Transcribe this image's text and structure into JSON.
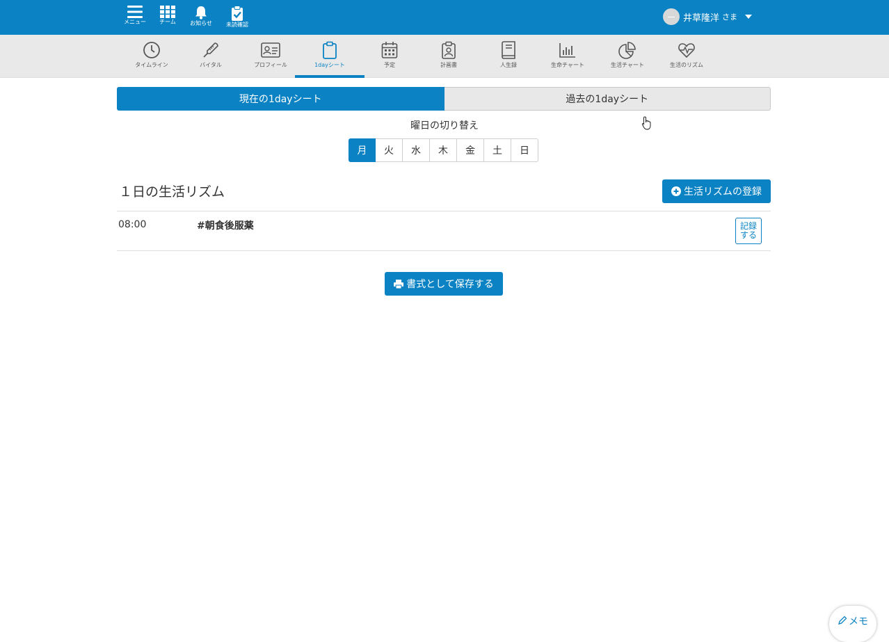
{
  "colors": {
    "brand": "#0a82c3",
    "navbar_bg": "#e9e9e9",
    "inactive_tab_bg": "#e8e8e8"
  },
  "topbar": {
    "buttons": [
      {
        "label": "メニュー",
        "icon": "menu-icon"
      },
      {
        "label": "チーム",
        "icon": "grid-icon"
      },
      {
        "label": "お知らせ",
        "icon": "bell-icon"
      },
      {
        "label": "未読確認",
        "icon": "clipboard-check-icon"
      }
    ],
    "user": {
      "name": "井草隆洋",
      "suffix": "さま"
    }
  },
  "nav": {
    "items": [
      {
        "label": "タイムライン",
        "icon": "clock-icon"
      },
      {
        "label": "バイタル",
        "icon": "thermometer-icon"
      },
      {
        "label": "プロフィール",
        "icon": "id-card-icon"
      },
      {
        "label": "1dayシート",
        "icon": "clipboard-icon",
        "active": true
      },
      {
        "label": "予定",
        "icon": "calendar-icon"
      },
      {
        "label": "計画書",
        "icon": "clipboard-user-icon"
      },
      {
        "label": "人生録",
        "icon": "book-icon"
      },
      {
        "label": "生命チャート",
        "icon": "bar-chart-icon"
      },
      {
        "label": "生活チャート",
        "icon": "pie-chart-icon"
      },
      {
        "label": "生活のリズム",
        "icon": "heart-pulse-icon"
      }
    ]
  },
  "sheet_toggle": {
    "current": "現在の1dayシート",
    "past": "過去の1dayシート"
  },
  "day_switch": {
    "title": "曜日の切り替え",
    "days": [
      "月",
      "火",
      "水",
      "木",
      "金",
      "土",
      "日"
    ],
    "selected": "月"
  },
  "rhythm": {
    "title": "１日の生活リズム",
    "register_label": "生活リズムの登録",
    "rows": [
      {
        "time": "08:00",
        "label": "#朝食後服薬",
        "record_label_line1": "記録",
        "record_label_line2": "する"
      }
    ]
  },
  "save_label": "書式として保存する",
  "memo_label": "メモ"
}
